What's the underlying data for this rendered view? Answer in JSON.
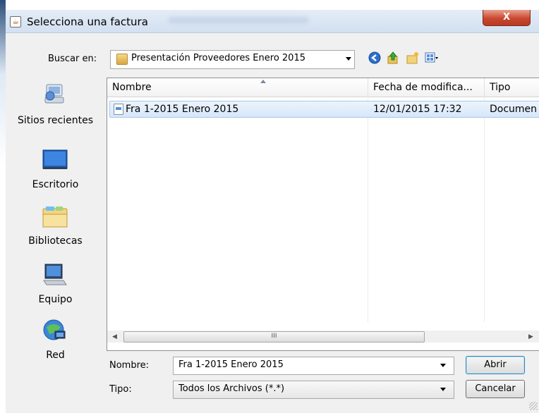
{
  "window": {
    "title": "Selecciona una factura",
    "close_label": "X"
  },
  "toolbar": {
    "look_in_label": "Buscar en:",
    "look_in_value": "Presentación Proveedores Enero 2015",
    "icons": [
      "back-icon",
      "up-folder-icon",
      "new-folder-icon",
      "view-menu-icon"
    ]
  },
  "places": [
    {
      "label": "Sitios recientes",
      "icon": "recent-places-icon"
    },
    {
      "label": "Escritorio",
      "icon": "desktop-icon"
    },
    {
      "label": "Bibliotecas",
      "icon": "libraries-icon"
    },
    {
      "label": "Equipo",
      "icon": "computer-icon"
    },
    {
      "label": "Red",
      "icon": "network-icon"
    }
  ],
  "file_list": {
    "columns": [
      "Nombre",
      "Fecha de modifica...",
      "Tipo"
    ],
    "rows": [
      {
        "name": "Fra 1-2015 Enero 2015",
        "modified": "12/01/2015 17:32",
        "type": "Documen"
      }
    ],
    "scroll_thumb_label": "III"
  },
  "form": {
    "name_label": "Nombre:",
    "name_value": "Fra 1-2015 Enero 2015",
    "type_label": "Tipo:",
    "type_value": "Todos los Archivos (*.*)"
  },
  "buttons": {
    "open": "Abrir",
    "cancel": "Cancelar"
  },
  "colors": {
    "selection": "#d7e7fa",
    "close_button": "#c9482f",
    "dialog_bg": "#f0f0f0"
  }
}
